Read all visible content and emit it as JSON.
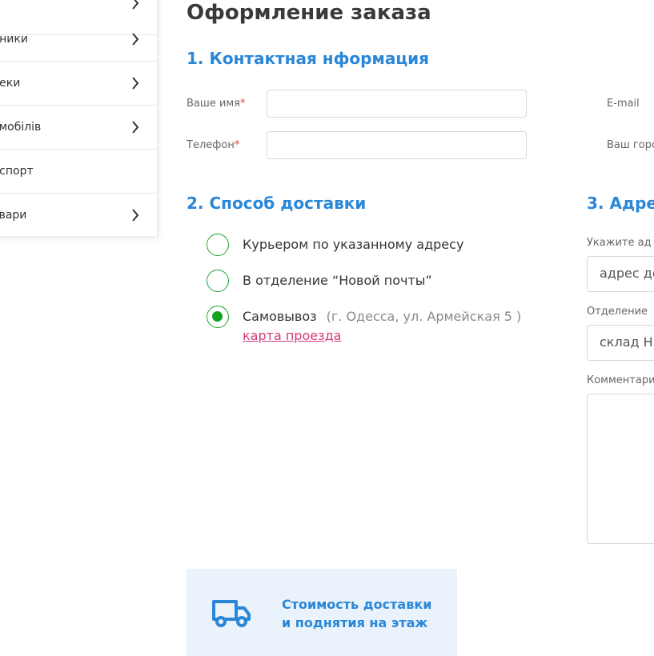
{
  "sidebar": {
    "items": [
      {
        "label": "",
        "has_arrow": true
      },
      {
        "label": "нники",
        "has_arrow": true
      },
      {
        "label": "пеки",
        "has_arrow": true
      },
      {
        "label": "омобілів",
        "has_arrow": true
      },
      {
        "label": "нспорт",
        "has_arrow": false
      },
      {
        "label": "овари",
        "has_arrow": true
      }
    ]
  },
  "page": {
    "title": "Оформление заказа"
  },
  "contact": {
    "section_title": "1. Контактная нформация",
    "name_label": "Ваше имя",
    "phone_label": "Телефон",
    "required_mark": "*",
    "name_value": "",
    "phone_value": "",
    "email_label": "E-mail",
    "city_label": "Ваш горо"
  },
  "delivery": {
    "section_title": "2. Способ доставки",
    "options": [
      {
        "label": "Курьером по указанному адресу",
        "checked": false
      },
      {
        "label": "В отделение “Новой почты”",
        "checked": false
      },
      {
        "label": "Самовывоз",
        "note": "(г. Одесса, ул. Армейская 5 )",
        "checked": true
      }
    ],
    "map_link": "карта проезда"
  },
  "address": {
    "section_title": "3. Адре",
    "address_label": "Укажите ад",
    "address_value": "адрес до",
    "branch_label": "Отделение",
    "branch_value": "склад Н",
    "comment_label": "Комментари"
  },
  "delivery_cost": {
    "line1": "Стоимость доставки",
    "line2": "и поднятия на этаж",
    "icon": "truck-icon"
  },
  "colors": {
    "accent_blue": "#2a87d8",
    "radio_green": "#13a41f",
    "link_pink": "#d23a7a",
    "required_red": "#e23e3e",
    "cost_bg": "#eaf2fb"
  }
}
